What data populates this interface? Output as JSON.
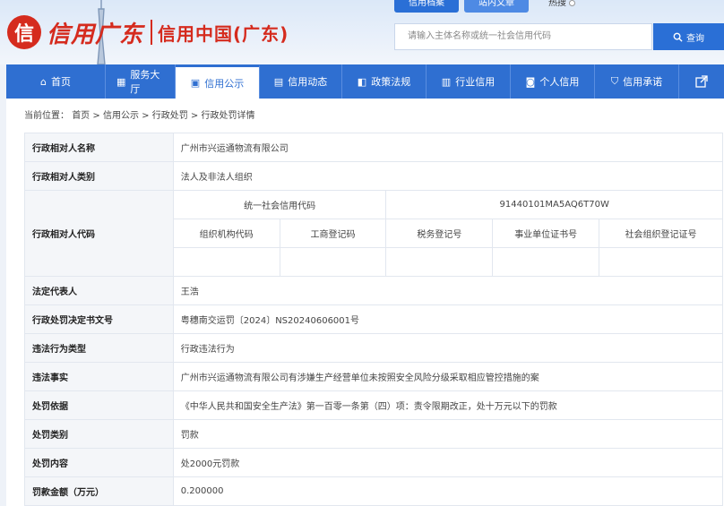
{
  "header": {
    "logo_script": "信用广东",
    "logo_text": "信用中国(广东)",
    "top_tabs": [
      "信用档案",
      "站内文章",
      "热搜"
    ],
    "search_placeholder": "请输入主体名称或统一社会信用代码",
    "search_button": "查询"
  },
  "nav": {
    "items": [
      {
        "label": "首页",
        "icon": "home-icon"
      },
      {
        "label": "服务大厅",
        "icon": "grid-icon"
      },
      {
        "label": "信用公示",
        "icon": "briefcase-icon",
        "active": true
      },
      {
        "label": "信用动态",
        "icon": "news-icon"
      },
      {
        "label": "政策法规",
        "icon": "book-icon"
      },
      {
        "label": "行业信用",
        "icon": "building-icon"
      },
      {
        "label": "个人信用",
        "icon": "person-icon"
      },
      {
        "label": "信用承诺",
        "icon": "shield-icon"
      }
    ]
  },
  "breadcrumb": {
    "prefix": "当前位置：",
    "items": [
      "首页",
      "信用公示",
      "行政处罚",
      "行政处罚详情"
    ]
  },
  "detail": {
    "name_label": "行政相对人名称",
    "name_value": "广州市兴运通物流有限公司",
    "category_label": "行政相对人类别",
    "category_value": "法人及非法人组织",
    "code_label": "行政相对人代码",
    "uscc_label": "统一社会信用代码",
    "uscc_value": "91440101MA5AQ6T70W",
    "sub_headers": [
      "组织机构代码",
      "工商登记码",
      "税务登记号",
      "事业单位证书号",
      "社会组织登记证号"
    ],
    "legal_rep_label": "法定代表人",
    "legal_rep_value": "王浩",
    "doc_no_label": "行政处罚决定书文号",
    "doc_no_value": "粤穗南交运罚〔2024〕NS20240606001号",
    "violation_type_label": "违法行为类型",
    "violation_type_value": "行政违法行为",
    "facts_label": "违法事实",
    "facts_value": "广州市兴运通物流有限公司有涉嫌生产经营单位未按照安全风险分级采取相应管控措施的案",
    "basis_label": "处罚依据",
    "basis_value": "《中华人民共和国安全生产法》第一百零一条第（四）项：责令限期改正，处十万元以下的罚款",
    "penalty_type_label": "处罚类别",
    "penalty_type_value": "罚款",
    "penalty_content_label": "处罚内容",
    "penalty_content_value": "处2000元罚款",
    "amount_label": "罚款金额（万元）",
    "amount_value": "0.200000"
  },
  "colors": {
    "brand_red": "#d52b1e",
    "nav_blue": "#2f6fd1"
  }
}
